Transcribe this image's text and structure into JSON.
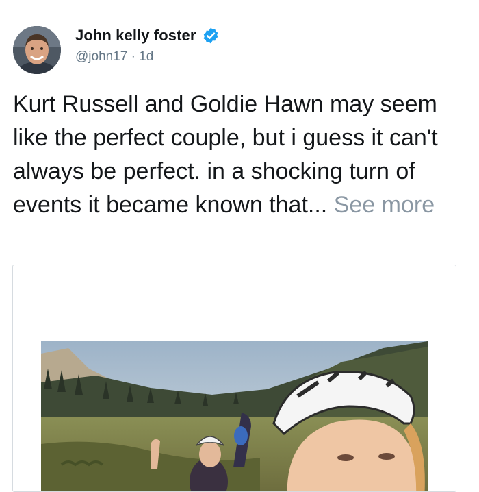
{
  "author": {
    "name": "John kelly foster",
    "verified": true,
    "handle": "@john17",
    "separator": "·",
    "time": "1d"
  },
  "tweet": {
    "text": "Kurt Russell and Goldie Hawn may seem like the perfect couple, but i guess it can't always be perfect. in a shocking turn of events it became known that...",
    "see_more_label": "See more"
  },
  "colors": {
    "verified_badge": "#1da1f2",
    "handle_gray": "#657786",
    "see_more_gray": "#8a97a3",
    "card_border": "#d6dbe0"
  },
  "icons": {
    "verified": "verified-badge-icon"
  }
}
